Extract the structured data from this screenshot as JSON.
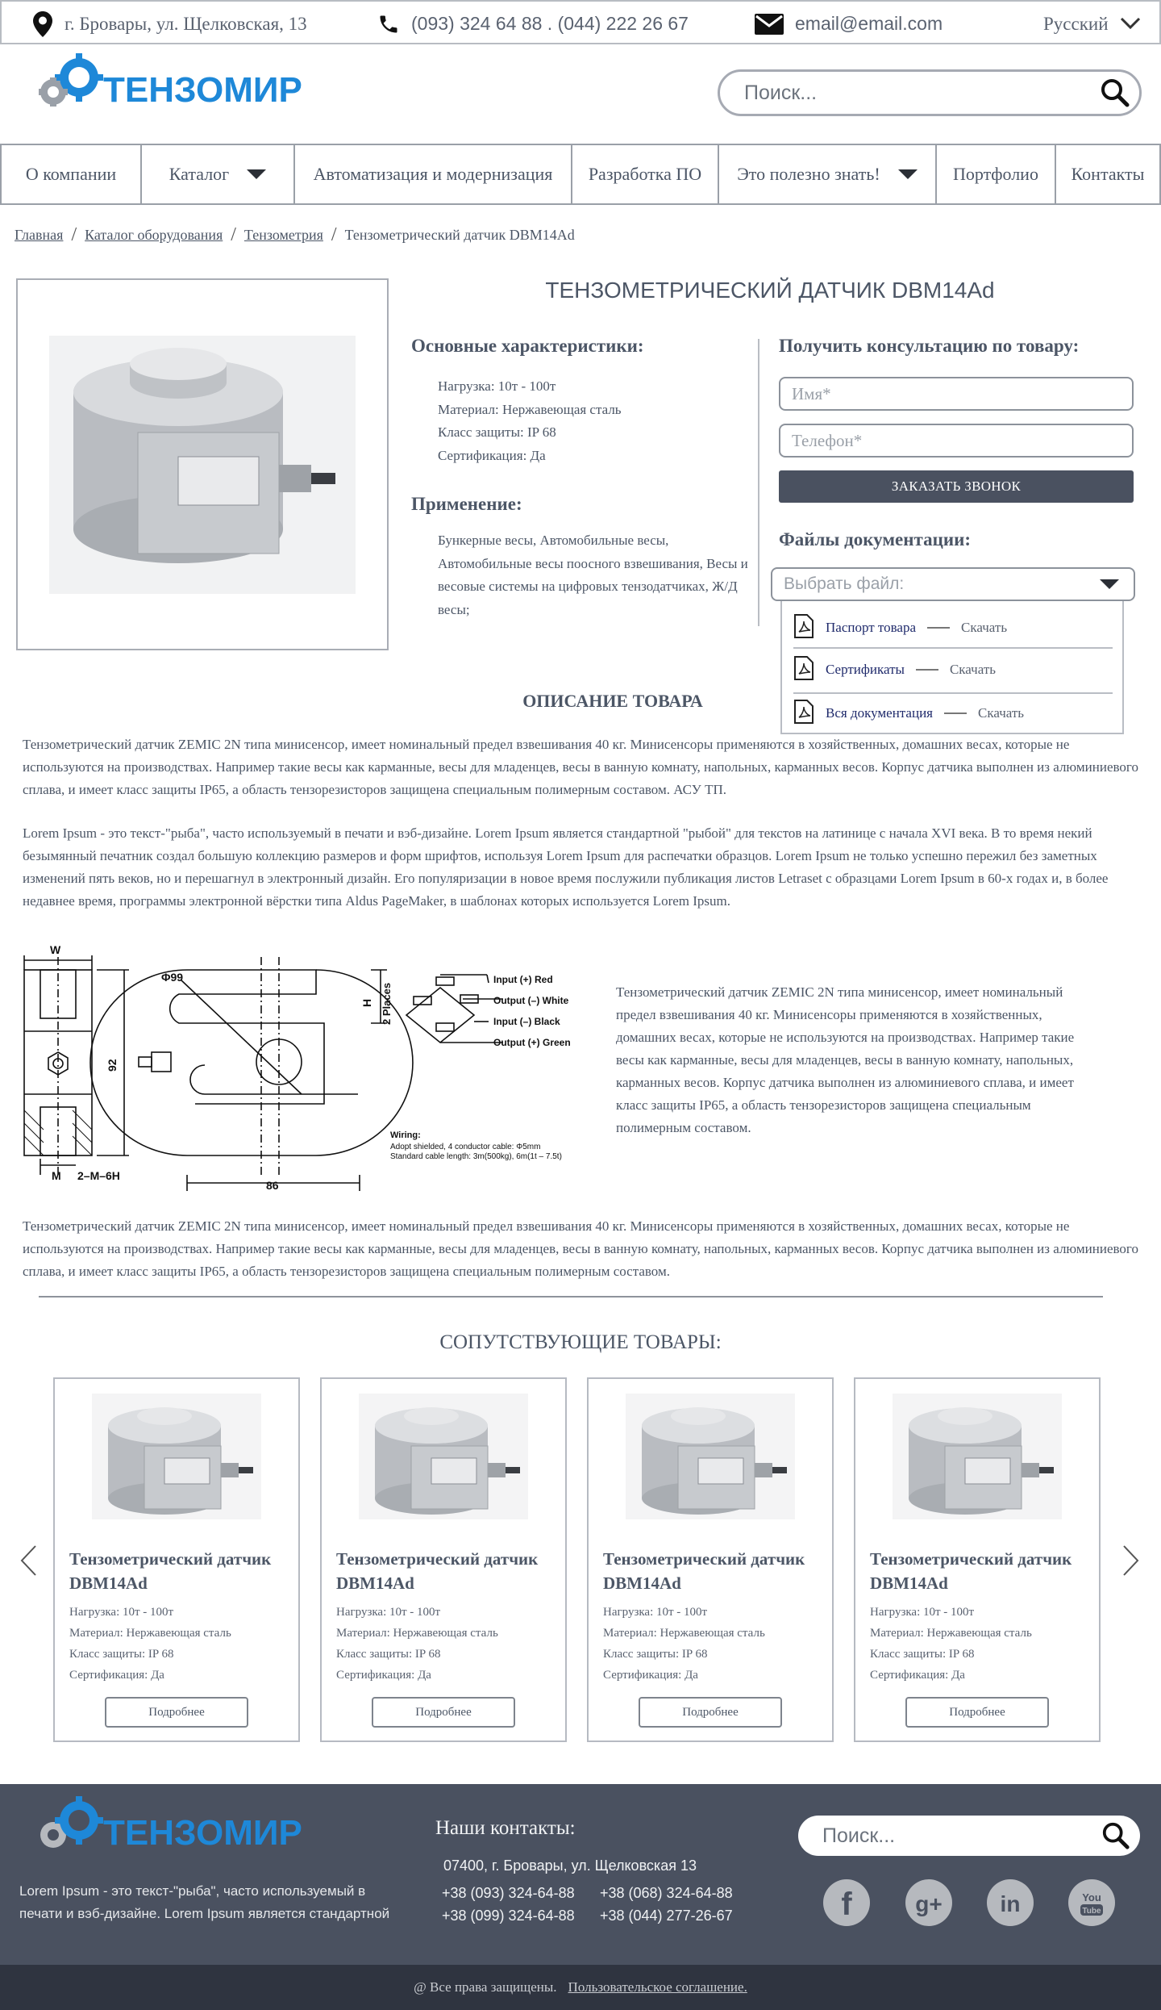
{
  "topbar": {
    "address": "г. Бровары, ул. Щелковская, 13",
    "phones": "(093) 324 64 88 . (044) 222 26 67",
    "email": "email@email.com",
    "language": "Русский"
  },
  "brand": {
    "name": "ТЕНЗОМИР"
  },
  "search": {
    "placeholder": "Поиск..."
  },
  "nav": {
    "items": [
      {
        "label": "О компании"
      },
      {
        "label": "Каталог"
      },
      {
        "label": "Автоматизация и модернизация"
      },
      {
        "label": "Разработка ПО"
      },
      {
        "label": "Это полезно знать!"
      },
      {
        "label": "Портфолио"
      },
      {
        "label": "Контакты"
      }
    ]
  },
  "breadcrumbs": {
    "items": [
      "Главная",
      "Каталог оборудования",
      "Тензометрия"
    ],
    "current": "Тензометрический датчик DBM14Ad"
  },
  "product": {
    "title": "ТЕНЗОМЕТРИЧЕСКИЙ ДАТЧИК DBM14Ad",
    "specs_title": "Основные характеристики:",
    "specs": [
      "Нагрузка: 10т - 100т",
      "Материал: Нержавеющая сталь",
      "Класс защиты: IP 68",
      "Сертификация: Да"
    ],
    "app_title": "Применение:",
    "app_text": "Бункерные весы, Автомобильные весы, Автомобильные весы поосного взвешивания, Весы и весовые системы на цифровых тензодатчиках, Ж/Д весы;"
  },
  "consult": {
    "title": "Получить консультацию по товару:",
    "name_placeholder": "Имя*",
    "phone_placeholder": "Телефон*",
    "button": "ЗАКАЗАТЬ ЗВОНОК"
  },
  "docs": {
    "title": "Файлы документации:",
    "select_placeholder": "Выбрать файл:",
    "files": [
      {
        "name": "Паспорт товара",
        "action": "Скачать"
      },
      {
        "name": "Сертификаты",
        "action": "Скачать"
      },
      {
        "name": "Вся документация",
        "action": "Скачать"
      }
    ]
  },
  "description": {
    "title": "ОПИСАНИЕ ТОВАРА",
    "p1": "Тензометрический датчик ZEMIC 2N типа минисенсор, имеет номинальный предел взвешивания 40 кг. Минисенсоры применяются в хозяйственных, домашних весах, которые не используются на производствах. Например такие весы как карманные, весы для младенцев, весы в ванную комнату, напольных, карманных весов. Корпус датчика выполнен из алюминиевого сплава, и имеет класс защиты IP65, а область тензорезисторов защищена специальным полимерным составом. АСУ ТП.",
    "p2": "Lorem Ipsum - это текст-\"рыба\", часто используемый в печати и вэб-дизайне. Lorem Ipsum является стандартной \"рыбой\" для текстов на латинице с начала XVI века. В то время некий безымянный печатник создал большую коллекцию размеров и форм шрифтов, используя Lorem Ipsum для распечатки образцов. Lorem Ipsum не только успешно пережил без заметных изменений пять веков, но и перешагнул в электронный дизайн. Его популяризации в новое время послужили публикация листов Letraset с образцами Lorem Ipsum в 60-х годах и, в более недавнее время, программы электронной вёрстки типа Aldus PageMaker, в шаблонах которых используется Lorem Ipsum.",
    "diagram_text": "Тензометрический датчик ZEMIC 2N типа минисенсор, имеет номинальный предел взвешивания 40 кг. Минисенсоры применяются в хозяйственных, домашних весах, которые не используются на производствах. Например такие весы как карманные, весы для младенцев, весы в ванную комнату, напольных, карманных весов. Корпус датчика выполнен из алюминиевого сплава, и имеет класс защиты IP65, а область тензорезисторов защищена специальным полимерным составом.",
    "p3": "Тензометрический датчик ZEMIC 2N типа минисенсор, имеет номинальный предел взвешивания 40 кг. Минисенсоры применяются в хозяйственных, домашних весах, которые не используются на производствах. Например такие весы как карманные, весы для младенцев, весы в ванную комнату, напольных, карманных весов. Корпус датчика выполнен из алюминиевого сплава, и имеет класс защиты IP65, а область тензорезисторов защищена специальным полимерным составом."
  },
  "diagram": {
    "dim_w": "W",
    "dim_phi": "Φ99",
    "dim_92": "92",
    "dim_h": "H",
    "dim_places": "2 Places",
    "dim_m": "M",
    "dim_thread": "2–M–6H",
    "dim_86": "86",
    "wires": [
      "Input (+) Red",
      "Output (–) White",
      "Input (–) Black",
      "Output (+) Green"
    ],
    "wiring_title": "Wiring:",
    "wiring_1": "Adopt shielded, 4 conductor cable: Φ5mm",
    "wiring_2": "Standard cable length: 3m(500kg), 6m(1t – 7.5t)"
  },
  "related": {
    "title": "СОПУТСТВУЮЩИЕ ТОВАРЫ:",
    "items": [
      {
        "name_1": "Тензометрический датчик",
        "name_2": "DBM14Ad",
        "specs": [
          "Нагрузка: 10т - 100т",
          "Материал: Нержавеющая сталь",
          "Класс защиты: IP 68",
          "Сертификация: Да"
        ],
        "button": "Подробнее"
      },
      {
        "name_1": "Тензометрический датчик",
        "name_2": "DBM14Ad",
        "specs": [
          "Нагрузка: 10т - 100т",
          "Материал: Нержавеющая сталь",
          "Класс защиты: IP 68",
          "Сертификация: Да"
        ],
        "button": "Подробнее"
      },
      {
        "name_1": "Тензометрический датчик",
        "name_2": "DBM14Ad",
        "specs": [
          "Нагрузка: 10т - 100т",
          "Материал: Нержавеющая сталь",
          "Класс защиты: IP 68",
          "Сертификация: Да"
        ],
        "button": "Подробнее"
      },
      {
        "name_1": "Тензометрический датчик",
        "name_2": "DBM14Ad",
        "specs": [
          "Нагрузка: 10т - 100т",
          "Материал: Нержавеющая сталь",
          "Класс защиты: IP 68",
          "Сертификация: Да"
        ],
        "button": "Подробнее"
      }
    ]
  },
  "footer": {
    "lorem": "Lorem Ipsum - это текст-\"рыба\", часто используемый в печати и вэб-дизайне. Lorem Ipsum является стандартной",
    "contacts_title": "Наши контакты:",
    "address": "07400, г. Бровары, ул. Щелковская 13",
    "phones": [
      "+38 (093) 324-64-88",
      "+38 (068) 324-64-88",
      "+38 (099) 324-64-88",
      "+38 (044) 277-26-67"
    ],
    "search_placeholder": "Поиск...",
    "social": [
      "facebook-icon",
      "google-plus-icon",
      "linkedin-icon",
      "youtube-icon"
    ],
    "copyright": "@ Все права защищены.",
    "agreement": "Пользовательское соглашение."
  },
  "colors": {
    "accent": "#1e88d8",
    "dark": "#4a5160",
    "footer_bottom": "#2f3440",
    "text": "#4c5666"
  }
}
